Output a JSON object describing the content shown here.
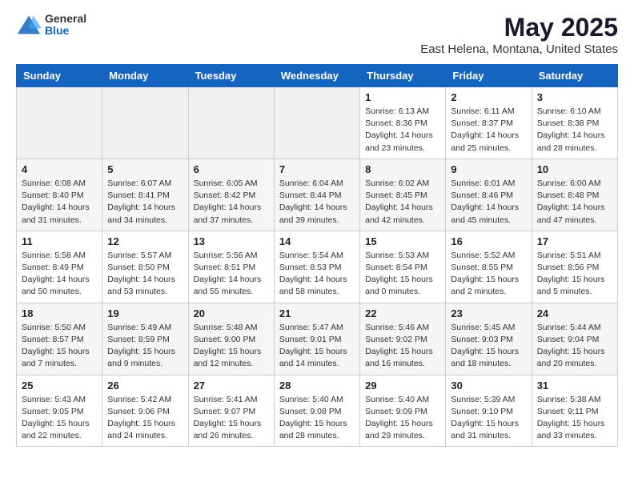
{
  "header": {
    "logo_general": "General",
    "logo_blue": "Blue",
    "title": "May 2025",
    "subtitle": "East Helena, Montana, United States"
  },
  "weekdays": [
    "Sunday",
    "Monday",
    "Tuesday",
    "Wednesday",
    "Thursday",
    "Friday",
    "Saturday"
  ],
  "weeks": [
    [
      {
        "day": "",
        "info": ""
      },
      {
        "day": "",
        "info": ""
      },
      {
        "day": "",
        "info": ""
      },
      {
        "day": "",
        "info": ""
      },
      {
        "day": "1",
        "info": "Sunrise: 6:13 AM\nSunset: 8:36 PM\nDaylight: 14 hours\nand 23 minutes."
      },
      {
        "day": "2",
        "info": "Sunrise: 6:11 AM\nSunset: 8:37 PM\nDaylight: 14 hours\nand 25 minutes."
      },
      {
        "day": "3",
        "info": "Sunrise: 6:10 AM\nSunset: 8:38 PM\nDaylight: 14 hours\nand 28 minutes."
      }
    ],
    [
      {
        "day": "4",
        "info": "Sunrise: 6:08 AM\nSunset: 8:40 PM\nDaylight: 14 hours\nand 31 minutes."
      },
      {
        "day": "5",
        "info": "Sunrise: 6:07 AM\nSunset: 8:41 PM\nDaylight: 14 hours\nand 34 minutes."
      },
      {
        "day": "6",
        "info": "Sunrise: 6:05 AM\nSunset: 8:42 PM\nDaylight: 14 hours\nand 37 minutes."
      },
      {
        "day": "7",
        "info": "Sunrise: 6:04 AM\nSunset: 8:44 PM\nDaylight: 14 hours\nand 39 minutes."
      },
      {
        "day": "8",
        "info": "Sunrise: 6:02 AM\nSunset: 8:45 PM\nDaylight: 14 hours\nand 42 minutes."
      },
      {
        "day": "9",
        "info": "Sunrise: 6:01 AM\nSunset: 8:46 PM\nDaylight: 14 hours\nand 45 minutes."
      },
      {
        "day": "10",
        "info": "Sunrise: 6:00 AM\nSunset: 8:48 PM\nDaylight: 14 hours\nand 47 minutes."
      }
    ],
    [
      {
        "day": "11",
        "info": "Sunrise: 5:58 AM\nSunset: 8:49 PM\nDaylight: 14 hours\nand 50 minutes."
      },
      {
        "day": "12",
        "info": "Sunrise: 5:57 AM\nSunset: 8:50 PM\nDaylight: 14 hours\nand 53 minutes."
      },
      {
        "day": "13",
        "info": "Sunrise: 5:56 AM\nSunset: 8:51 PM\nDaylight: 14 hours\nand 55 minutes."
      },
      {
        "day": "14",
        "info": "Sunrise: 5:54 AM\nSunset: 8:53 PM\nDaylight: 14 hours\nand 58 minutes."
      },
      {
        "day": "15",
        "info": "Sunrise: 5:53 AM\nSunset: 8:54 PM\nDaylight: 15 hours\nand 0 minutes."
      },
      {
        "day": "16",
        "info": "Sunrise: 5:52 AM\nSunset: 8:55 PM\nDaylight: 15 hours\nand 2 minutes."
      },
      {
        "day": "17",
        "info": "Sunrise: 5:51 AM\nSunset: 8:56 PM\nDaylight: 15 hours\nand 5 minutes."
      }
    ],
    [
      {
        "day": "18",
        "info": "Sunrise: 5:50 AM\nSunset: 8:57 PM\nDaylight: 15 hours\nand 7 minutes."
      },
      {
        "day": "19",
        "info": "Sunrise: 5:49 AM\nSunset: 8:59 PM\nDaylight: 15 hours\nand 9 minutes."
      },
      {
        "day": "20",
        "info": "Sunrise: 5:48 AM\nSunset: 9:00 PM\nDaylight: 15 hours\nand 12 minutes."
      },
      {
        "day": "21",
        "info": "Sunrise: 5:47 AM\nSunset: 9:01 PM\nDaylight: 15 hours\nand 14 minutes."
      },
      {
        "day": "22",
        "info": "Sunrise: 5:46 AM\nSunset: 9:02 PM\nDaylight: 15 hours\nand 16 minutes."
      },
      {
        "day": "23",
        "info": "Sunrise: 5:45 AM\nSunset: 9:03 PM\nDaylight: 15 hours\nand 18 minutes."
      },
      {
        "day": "24",
        "info": "Sunrise: 5:44 AM\nSunset: 9:04 PM\nDaylight: 15 hours\nand 20 minutes."
      }
    ],
    [
      {
        "day": "25",
        "info": "Sunrise: 5:43 AM\nSunset: 9:05 PM\nDaylight: 15 hours\nand 22 minutes."
      },
      {
        "day": "26",
        "info": "Sunrise: 5:42 AM\nSunset: 9:06 PM\nDaylight: 15 hours\nand 24 minutes."
      },
      {
        "day": "27",
        "info": "Sunrise: 5:41 AM\nSunset: 9:07 PM\nDaylight: 15 hours\nand 26 minutes."
      },
      {
        "day": "28",
        "info": "Sunrise: 5:40 AM\nSunset: 9:08 PM\nDaylight: 15 hours\nand 28 minutes."
      },
      {
        "day": "29",
        "info": "Sunrise: 5:40 AM\nSunset: 9:09 PM\nDaylight: 15 hours\nand 29 minutes."
      },
      {
        "day": "30",
        "info": "Sunrise: 5:39 AM\nSunset: 9:10 PM\nDaylight: 15 hours\nand 31 minutes."
      },
      {
        "day": "31",
        "info": "Sunrise: 5:38 AM\nSunset: 9:11 PM\nDaylight: 15 hours\nand 33 minutes."
      }
    ]
  ]
}
